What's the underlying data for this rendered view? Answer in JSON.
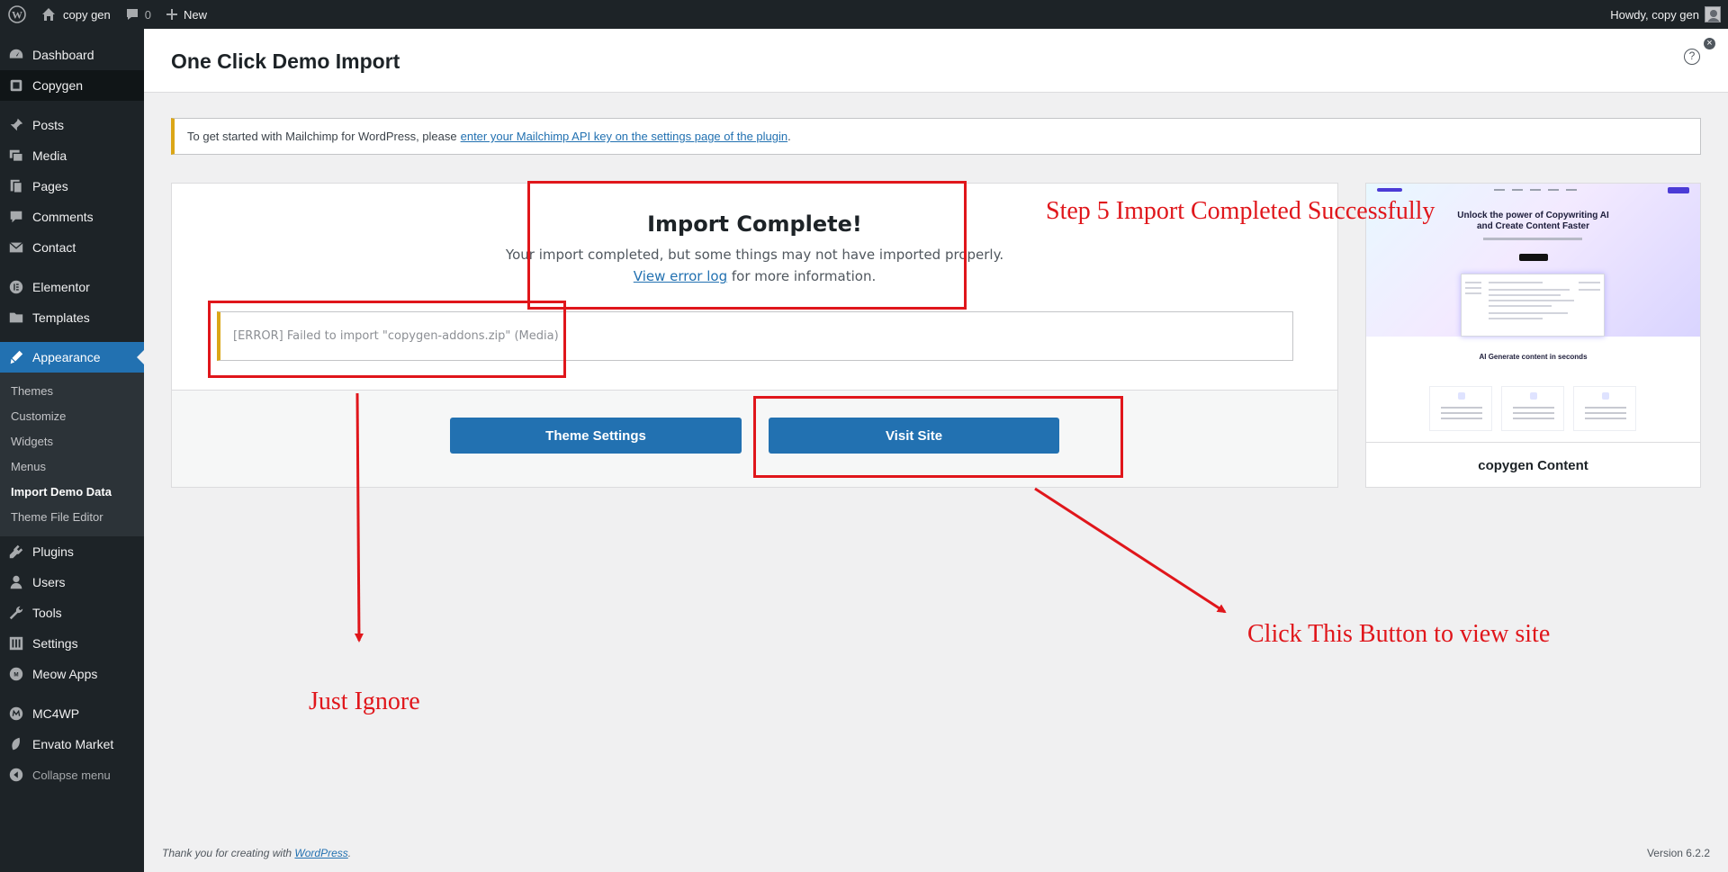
{
  "adminbar": {
    "site_name": "copy gen",
    "comments_count": "0",
    "new_label": "New",
    "howdy": "Howdy, copy gen"
  },
  "sidebar": {
    "items_top": [
      {
        "label": "Dashboard",
        "icon": "dashboard-icon"
      },
      {
        "label": "Copygen",
        "icon": "copygen-icon"
      }
    ],
    "items_content": [
      {
        "label": "Posts",
        "icon": "pin-icon"
      },
      {
        "label": "Media",
        "icon": "media-icon"
      },
      {
        "label": "Pages",
        "icon": "pages-icon"
      },
      {
        "label": "Comments",
        "icon": "comment-icon"
      },
      {
        "label": "Contact",
        "icon": "mail-icon"
      }
    ],
    "items_builder": [
      {
        "label": "Elementor",
        "icon": "elementor-icon"
      },
      {
        "label": "Templates",
        "icon": "folder-icon"
      }
    ],
    "appearance": {
      "label": "Appearance",
      "icon": "brush-icon",
      "submenu": [
        "Themes",
        "Customize",
        "Widgets",
        "Menus",
        "Import Demo Data",
        "Theme File Editor"
      ]
    },
    "items_admin": [
      {
        "label": "Plugins",
        "icon": "plugin-icon"
      },
      {
        "label": "Users",
        "icon": "user-icon"
      },
      {
        "label": "Tools",
        "icon": "wrench-icon"
      },
      {
        "label": "Settings",
        "icon": "settings-icon"
      },
      {
        "label": "Meow Apps",
        "icon": "meow-icon"
      }
    ],
    "items_extra": [
      {
        "label": "MC4WP",
        "icon": "mc4wp-icon"
      },
      {
        "label": "Envato Market",
        "icon": "leaf-icon"
      }
    ],
    "collapse": "Collapse menu"
  },
  "page": {
    "title": "One Click Demo Import"
  },
  "notice": {
    "text": "To get started with Mailchimp for WordPress, please",
    "link": "enter your Mailchimp API key on the settings page of the plugin",
    "after": "."
  },
  "import": {
    "title": "Import Complete!",
    "message": "Your import completed, but some things may not have imported properly.",
    "log_link": "View error log",
    "log_after": " for more information.",
    "error": "[ERROR] Failed to import \"copygen-addons.zip\" (Media)",
    "theme_settings_button": "Theme Settings",
    "visit_site_button": "Visit Site"
  },
  "preview": {
    "headline_1": "Unlock the power of Copywriting AI",
    "headline_2": "and Create Content Faster",
    "section_title": "AI Generate content in seconds",
    "name": "copygen Content"
  },
  "footer": {
    "thanks": "Thank you for creating with",
    "link": "WordPress",
    "after": ".",
    "version": "Version 6.2.2"
  },
  "annotations": {
    "step5": "Step 5 Import Completed Successfully",
    "ignore": "Just Ignore",
    "click": "Click This Button to view site",
    "color": "#e0161b"
  }
}
